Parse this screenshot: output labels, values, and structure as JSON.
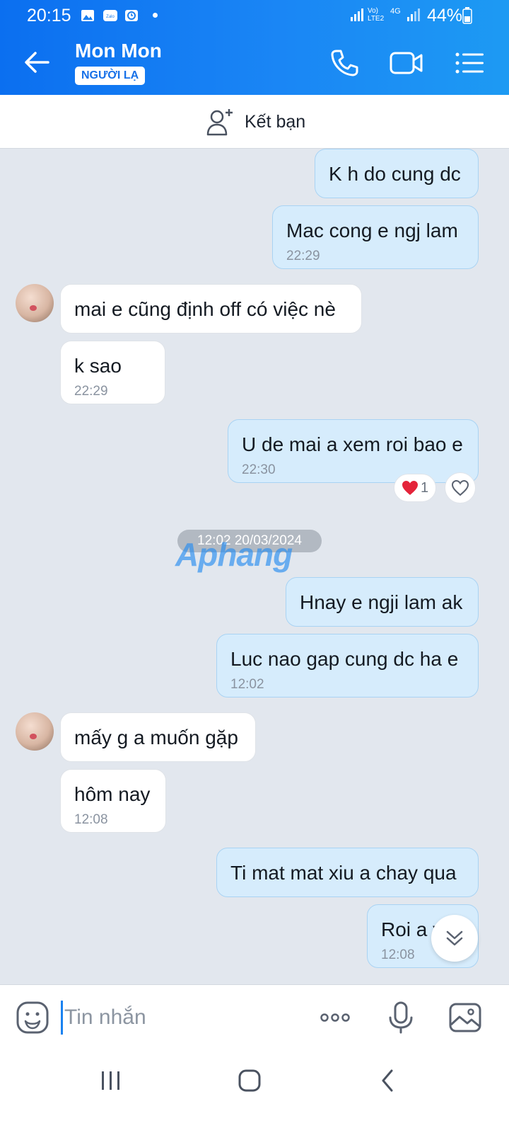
{
  "status_bar": {
    "time": "20:15",
    "network": "Vo) LTE2",
    "network_type": "4G",
    "battery_percent": "44%",
    "notification_icons": [
      "gallery-icon",
      "zalo-icon",
      "clock-app-icon"
    ]
  },
  "header": {
    "contact_name": "Mon Mon",
    "badge": "NGƯỜI LẠ"
  },
  "add_friend": {
    "label": "Kết bạn"
  },
  "messages": [
    {
      "sender": "me",
      "text": "K h do cung dc"
    },
    {
      "sender": "me",
      "text": "Mac cong e ngj lam",
      "time": "22:29"
    },
    {
      "sender": "them",
      "text": "mai e cũng định off có việc nè"
    },
    {
      "sender": "them",
      "text": "k sao",
      "time": "22:29"
    },
    {
      "sender": "me",
      "text": "U de mai a xem roi bao e",
      "time": "22:30",
      "reaction": {
        "emoji": "heart",
        "count": "1"
      }
    },
    {
      "sender": "me",
      "text": "Hnay e ngji lam ak"
    },
    {
      "sender": "me",
      "text": "Luc nao gap cung dc ha e",
      "time": "12:02"
    },
    {
      "sender": "them",
      "text": "mấy g a muốn gặp"
    },
    {
      "sender": "them",
      "text": "hôm nay",
      "time": "12:08"
    },
    {
      "sender": "me",
      "text": "Ti mat mat xiu a chay qua"
    },
    {
      "sender": "me",
      "text": "Roi a v",
      "time": "12:08"
    }
  ],
  "date_separator": "12:02 20/03/2024",
  "watermark": "Aphang",
  "composer": {
    "placeholder": "Tin nhắn"
  },
  "colors": {
    "header_gradient_start": "#0b6ff0",
    "header_gradient_end": "#1d9af3",
    "my_bubble": "#d6ecfc",
    "their_bubble": "#ffffff",
    "chat_background": "#e2e7ee"
  }
}
